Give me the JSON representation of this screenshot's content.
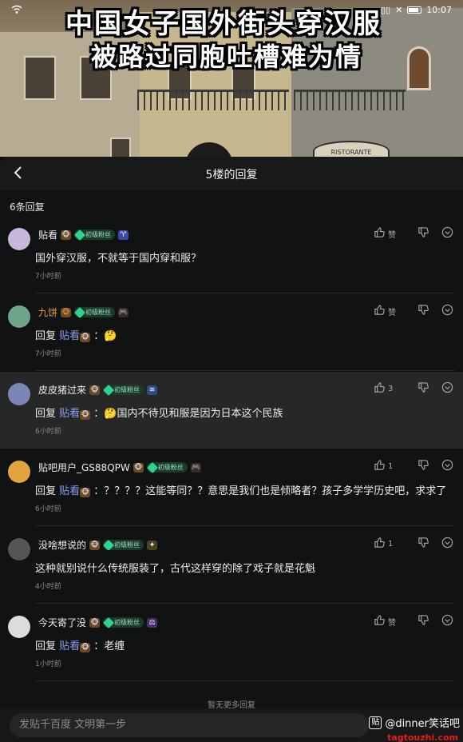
{
  "status_bar": {
    "left_text": "…",
    "time": "10:07"
  },
  "video": {
    "title_line1": "中国女子国外街头穿汉服",
    "title_line2": "被路过同胞吐槽难为情",
    "sign_text": "RISTORANTE"
  },
  "header": {
    "title": "5楼的回复",
    "back_icon": "chevron-left-icon"
  },
  "reply_count": "6条回复",
  "fan_badge_label": "初级粉丝",
  "comments": [
    {
      "username": "贴看",
      "vip": false,
      "prefix": "",
      "reply_to": "",
      "body": "国外穿汉服，不就等于国内穿和服？",
      "time": "7小时前",
      "likes": "赞",
      "highlighted": false,
      "extra_badge": "♈",
      "extra_badge_color": "#3b4aa8",
      "avatar_color": "#c9b8de"
    },
    {
      "username": "九饼",
      "vip": true,
      "prefix": "回复 ",
      "reply_to": "贴看",
      "body": " ：🤔",
      "time": "7小时前",
      "likes": "赞",
      "highlighted": false,
      "extra_badge": "🎮",
      "extra_badge_color": "#3a2a22",
      "avatar_color": "#6fa38a"
    },
    {
      "username": "皮皮猪过来",
      "vip": false,
      "prefix": "回复 ",
      "reply_to": "贴看",
      "body": " ：🤔国内不待见和服是因为日本这个民族",
      "time": "6小时前",
      "likes": "3",
      "highlighted": true,
      "extra_badge": "≋",
      "extra_badge_color": "#2c4b8a",
      "avatar_color": "#7c86b6"
    },
    {
      "username": "贴吧用户_GS88QPW",
      "vip": false,
      "prefix": "回复 ",
      "reply_to": "贴看",
      "body": " ：？？？？这能等同？？意思是我们也是倾略者？孩子多学学历史吧，求求了",
      "time": "6小时前",
      "likes": "1",
      "highlighted": false,
      "extra_badge": "🎮",
      "extra_badge_color": "#3a2a22",
      "avatar_color": "#e2a43c"
    },
    {
      "username": "没啥想说的",
      "vip": false,
      "prefix": "",
      "reply_to": "",
      "body": "这种就别说什么传统服装了，古代这样穿的除了戏子就是花魁",
      "time": "4小时前",
      "likes": "1",
      "highlighted": false,
      "extra_badge": "✦",
      "extra_badge_color": "#4a4320",
      "avatar_color": "#555555"
    },
    {
      "username": "今天寄了没",
      "vip": false,
      "prefix": "回复 ",
      "reply_to": "贴看",
      "body": " ：老缠",
      "time": "1小时前",
      "likes": "赞",
      "highlighted": false,
      "extra_badge": "⚖",
      "extra_badge_color": "#4a2f6e",
      "avatar_color": "#dcdcdc"
    }
  ],
  "no_more_text": "暂无更多回复",
  "input_placeholder": "发贴千百度 文明第一步",
  "watermark": {
    "text": "@dinner笑话吧",
    "logo": "贴",
    "red_text": "tagtouzhi.com"
  },
  "colors": {
    "accent_blue": "#8b9ff0",
    "badge_green": "#2fd38e",
    "vip_orange": "#e59a3b"
  }
}
